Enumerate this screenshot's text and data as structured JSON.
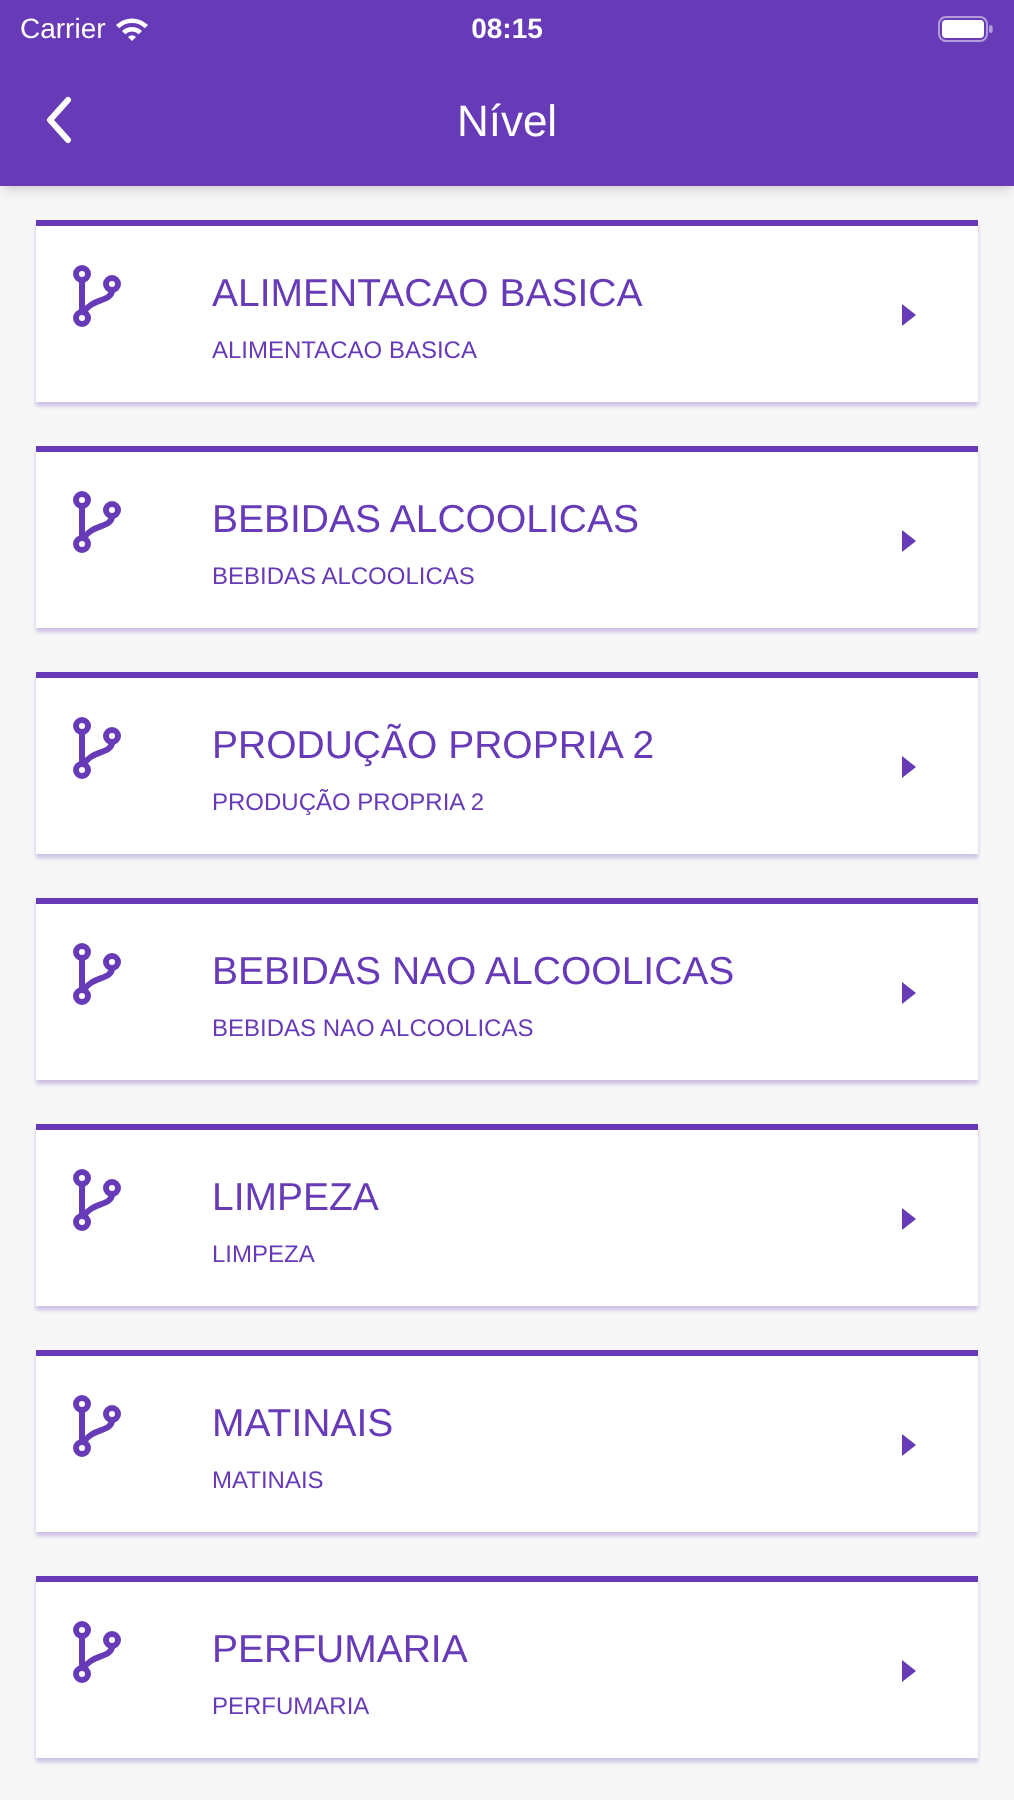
{
  "status_bar": {
    "carrier": "Carrier",
    "time": "08:15"
  },
  "nav_bar": {
    "title": "Nível"
  },
  "levels": [
    {
      "title": "ALIMENTACAO BASICA",
      "subtitle": "ALIMENTACAO BASICA"
    },
    {
      "title": "BEBIDAS ALCOOLICAS",
      "subtitle": "BEBIDAS ALCOOLICAS"
    },
    {
      "title": "PRODUÇÃO PROPRIA 2",
      "subtitle": "PRODUÇÃO PROPRIA 2"
    },
    {
      "title": "BEBIDAS NAO ALCOOLICAS",
      "subtitle": "BEBIDAS NAO ALCOOLICAS"
    },
    {
      "title": "LIMPEZA",
      "subtitle": "LIMPEZA"
    },
    {
      "title": "MATINAIS",
      "subtitle": "MATINAIS"
    },
    {
      "title": "PERFUMARIA",
      "subtitle": "PERFUMARIA"
    }
  ]
}
